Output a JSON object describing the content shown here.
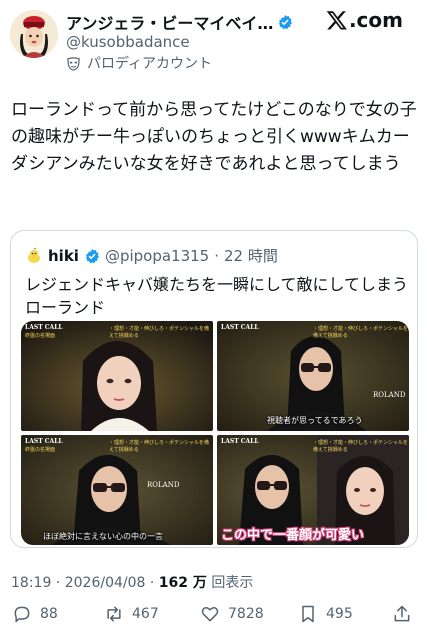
{
  "author": {
    "display_name": "アンジェラ・ビーマイベイ…",
    "handle": "@kusobbadance",
    "parody_label": "パロディアカウント"
  },
  "brand": {
    "logo": "x-logo",
    "suffix": ".com"
  },
  "tweet": {
    "text": "ローランドって前から思ってたけどこのなりで女の子の趣味がチー牛っぽいのちょっと引くwwwキムカーダシアンみたいな女を好きであれよと思ってしまう"
  },
  "quote": {
    "name": "hiki",
    "handle": "@pipopa1315",
    "separator": "·",
    "time": "22 時間",
    "text": "レジェンドキャバ嬢たちを一瞬にして敵にしてしまうローランド",
    "media": [
      {
        "show_tag": "LAST CALL",
        "show_sub": "終盤の名場面",
        "top_banner": "・理想・才能・伸びしろ・ポテンシャルを備えて挑戦める"
      },
      {
        "show_tag": "LAST CALL",
        "top_banner": "・理想・才能・伸びしろ・ポテンシャルを備えて挑戦める",
        "name_plate": "ROLAND",
        "caption": "視聴者が思ってるであろう"
      },
      {
        "show_tag": "LAST CALL",
        "show_sub": "終盤の名場面",
        "top_banner": "・理想・才能・伸びしろ・ポテンシャルを備えて挑戦める",
        "name_plate": "ROLAND",
        "caption": "ほぼ絶対に言えない心の中の一言"
      },
      {
        "show_tag": "LAST CALL",
        "top_banner": "・理想・才能・伸びしろ・ポテンシャルを備えて挑戦める",
        "caption": "この中で一番顔が可愛い"
      }
    ]
  },
  "meta": {
    "time": "18:19",
    "date": "2026/04/08",
    "views": "162 万",
    "views_label": "回表示"
  },
  "actions": {
    "replies": "88",
    "reposts": "467",
    "likes": "7828",
    "bookmarks": "495"
  },
  "colors": {
    "verified": "#1d9bf0",
    "text": "#0f1419",
    "secondary": "#536471",
    "border": "#cfd9de"
  }
}
